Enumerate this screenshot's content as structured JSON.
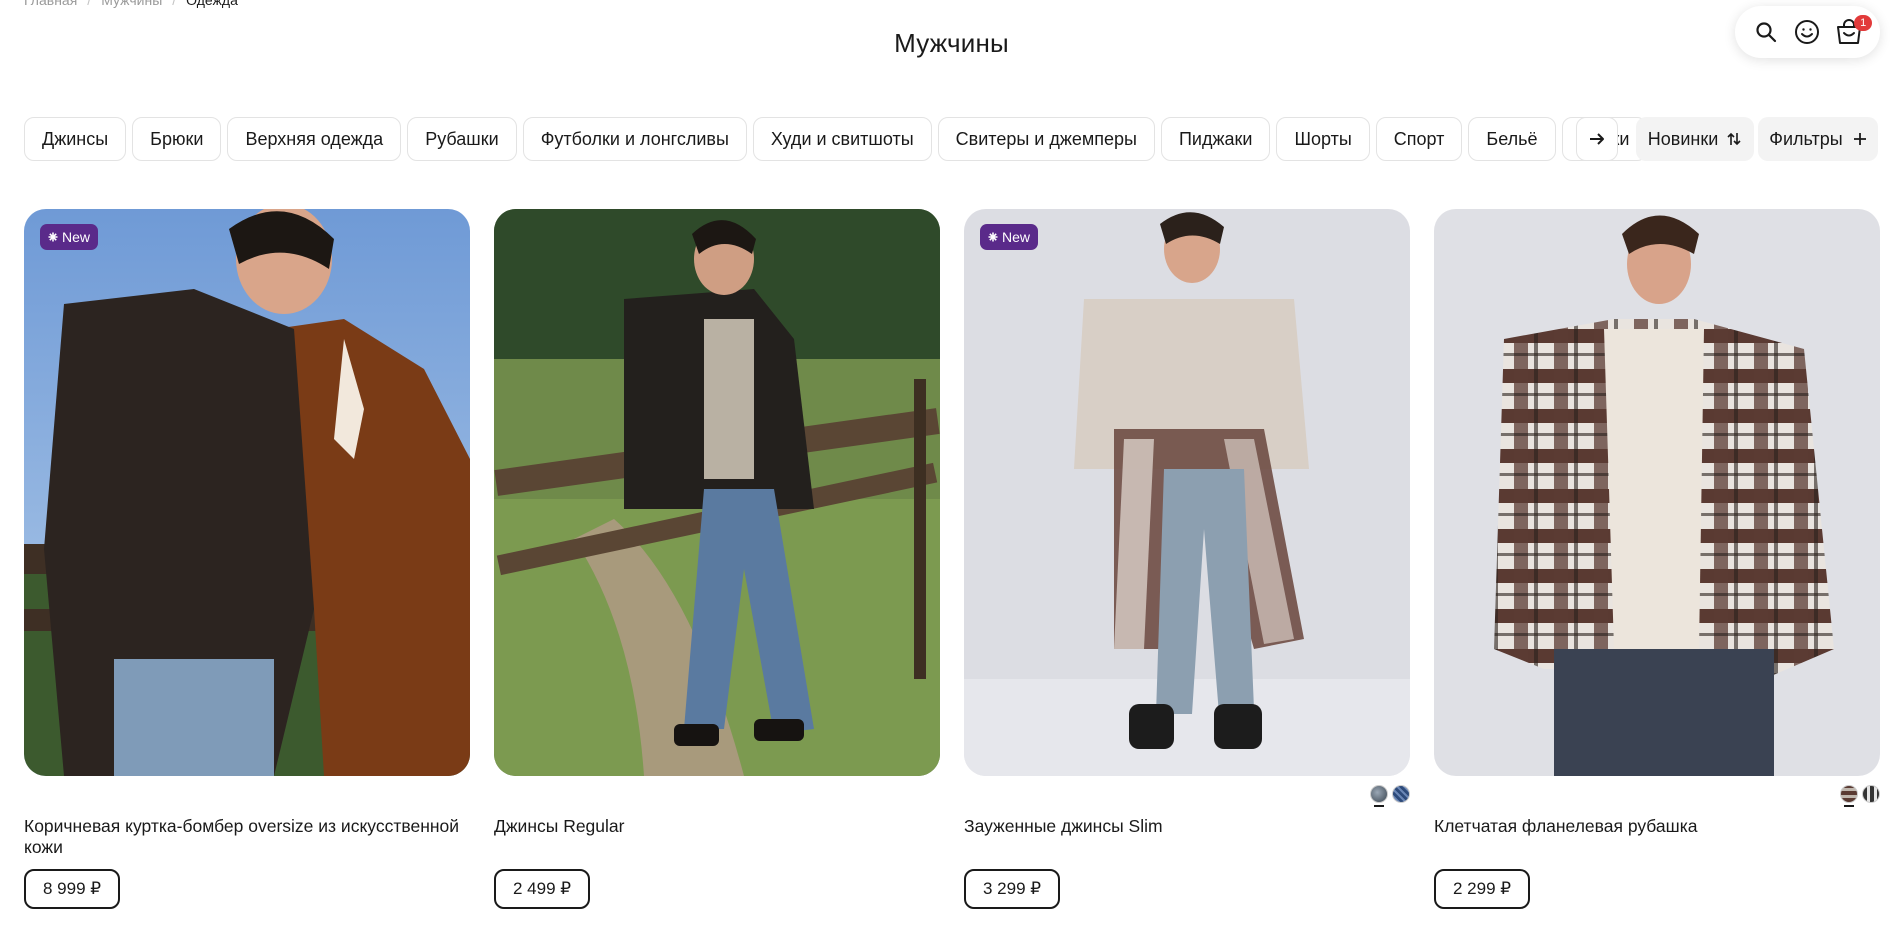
{
  "breadcrumb": [
    "Главная",
    "Мужчины",
    "Одежда"
  ],
  "page_title": "Мужчины",
  "header_actions": {
    "cart_count": "1"
  },
  "categories": [
    "Джинсы",
    "Брюки",
    "Верхняя одежда",
    "Рубашки",
    "Футболки и лонгсливы",
    "Худи и свитшоты",
    "Свитеры и джемперы",
    "Пиджаки",
    "Шорты",
    "Спорт",
    "Бельё",
    "Носки"
  ],
  "sort_label": "Новинки",
  "filters_label": "Фильтры",
  "badge_new_label": "New",
  "products": [
    {
      "title": "Коричневая куртка-бомбер oversize из искусственной кожи",
      "price": "8 999 ₽",
      "is_new": true
    },
    {
      "title": "Джинсы Regular",
      "price": "2 499 ₽",
      "is_new": false
    },
    {
      "title": "Зауженные джинсы Slim",
      "price": "3 299 ₽",
      "is_new": true
    },
    {
      "title": "Клетчатая фланелевая рубашка",
      "price": "2 299 ₽",
      "is_new": false
    }
  ],
  "colors": {
    "badge_new": "#5a2a8a",
    "cart_badge": "#e23a3a",
    "chip_border": "#e3e3e3",
    "button_bg": "#f3f3f3"
  },
  "icons": [
    "search-icon",
    "smiley-icon",
    "bag-icon",
    "arrow-right-icon",
    "sort-icon",
    "plus-icon",
    "sparkle-icon"
  ]
}
